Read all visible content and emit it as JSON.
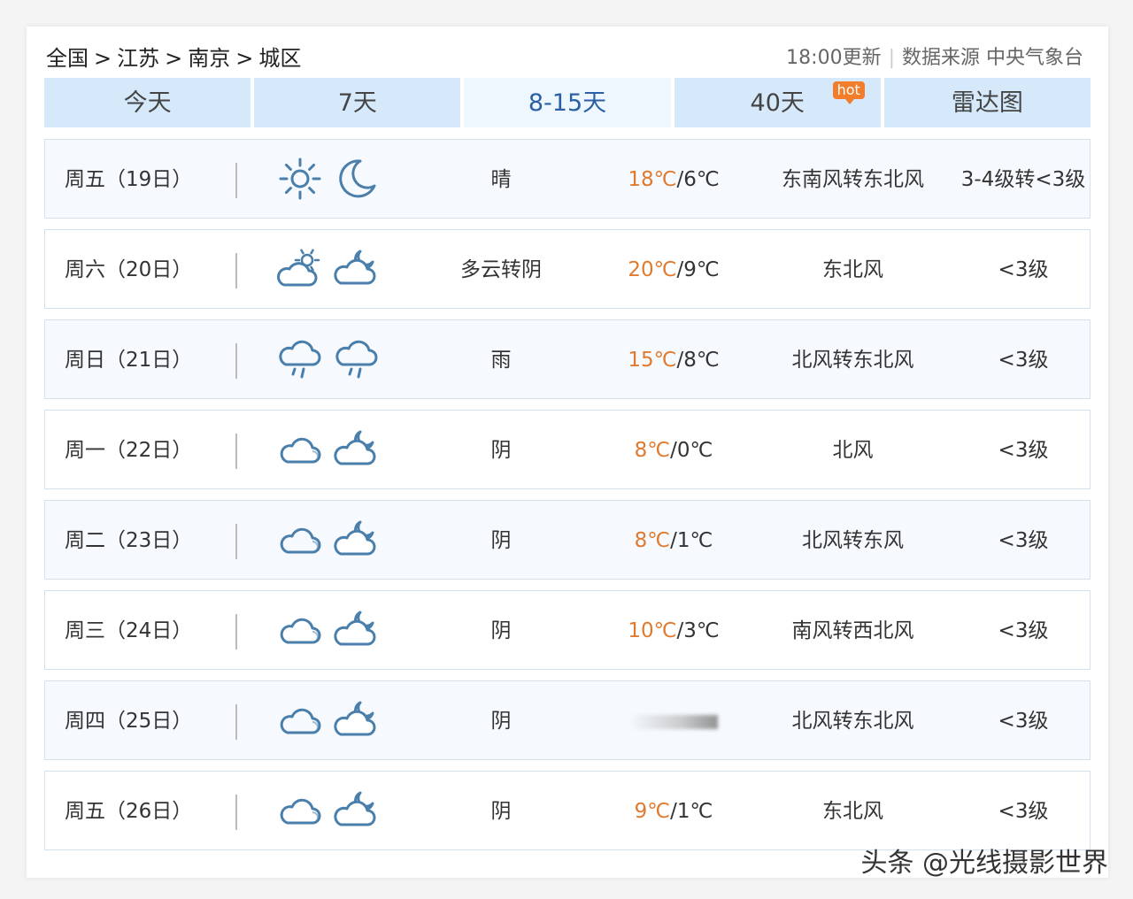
{
  "breadcrumb": [
    "全国",
    "江苏",
    "南京",
    "城区"
  ],
  "breadcrumb_sep": ">",
  "header": {
    "update": "18:00更新",
    "source": "数据来源 中央气象台"
  },
  "tabs": [
    {
      "label": "今天",
      "active": false
    },
    {
      "label": "7天",
      "active": false
    },
    {
      "label": "8-15天",
      "active": true
    },
    {
      "label": "40天",
      "active": false,
      "badge": "hot"
    },
    {
      "label": "雷达图",
      "active": false
    }
  ],
  "forecast": [
    {
      "date": "周五（19日）",
      "icon_day": "sun-icon",
      "icon_night": "moon-icon",
      "condition": "晴",
      "high": "18℃",
      "low": "6℃",
      "wind": "东南风转东北风",
      "level": "3-4级转<3级"
    },
    {
      "date": "周六（20日）",
      "icon_day": "partly-cloudy-icon",
      "icon_night": "cloudy-night-icon",
      "condition": "多云转阴",
      "high": "20℃",
      "low": "9℃",
      "wind": "东北风",
      "level": "<3级"
    },
    {
      "date": "周日（21日）",
      "icon_day": "rain-icon",
      "icon_night": "rain-icon",
      "condition": "雨",
      "high": "15℃",
      "low": "8℃",
      "wind": "北风转东北风",
      "level": "<3级"
    },
    {
      "date": "周一（22日）",
      "icon_day": "cloudy-icon",
      "icon_night": "cloudy-night-icon",
      "condition": "阴",
      "high": "8℃",
      "low": "0℃",
      "wind": "北风",
      "level": "<3级"
    },
    {
      "date": "周二（23日）",
      "icon_day": "cloudy-icon",
      "icon_night": "cloudy-night-icon",
      "condition": "阴",
      "high": "8℃",
      "low": "1℃",
      "wind": "北风转东风",
      "level": "<3级"
    },
    {
      "date": "周三（24日）",
      "icon_day": "cloudy-icon",
      "icon_night": "cloudy-night-icon",
      "condition": "阴",
      "high": "10℃",
      "low": "3℃",
      "wind": "南风转西北风",
      "level": "<3级"
    },
    {
      "date": "周四（25日）",
      "icon_day": "cloudy-icon",
      "icon_night": "cloudy-night-icon",
      "condition": "阴",
      "high": "",
      "low": "",
      "wind": "北风转东北风",
      "level": "<3级"
    },
    {
      "date": "周五（26日）",
      "icon_day": "cloudy-icon",
      "icon_night": "cloudy-night-icon",
      "condition": "阴",
      "high": "9℃",
      "low": "1℃",
      "wind": "东北风",
      "level": "<3级"
    }
  ],
  "watermark": "头条 @光线摄影世界",
  "colors": {
    "accent": "#2a5fa6",
    "high_temp": "#e07a2e",
    "tab_bg": "#d6e9fb",
    "icon": "#4a7fab"
  }
}
